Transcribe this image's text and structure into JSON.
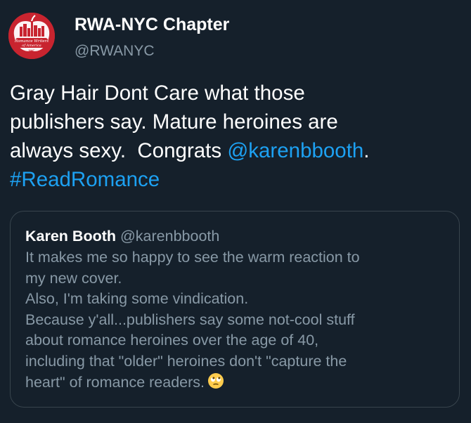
{
  "tweet": {
    "author": {
      "display_name": "RWA-NYC Chapter",
      "handle": "@RWANYC",
      "avatar_text": "Romance Writers of America NYC"
    },
    "body": {
      "line1": "Gray Hair Dont Care what those",
      "line2": "publishers say. Mature heroines are",
      "line3_text": "always sexy.  Congrats ",
      "mention": "@karenbbooth",
      "line3_end": ".",
      "hashtag": "#ReadRomance"
    },
    "quoted_tweet": {
      "display_name": "Karen Booth",
      "handle": "@karenbbooth",
      "lines": [
        "It makes me so happy to see the warm reaction to",
        "my new cover.",
        "Also, I'm taking some vindication.",
        "Because y'all...publishers say some not-cool stuff",
        "about romance heroines over the age of 40,",
        "including that \"older\" heroines don't \"capture the",
        "heart\" of romance readers."
      ],
      "emoji": "face-with-rolling-eyes-emoji"
    }
  },
  "colors": {
    "background": "#15202b",
    "link": "#1da1f2",
    "secondary_text": "#8899a6",
    "border": "#38444d",
    "avatar_red": "#c8242f"
  }
}
